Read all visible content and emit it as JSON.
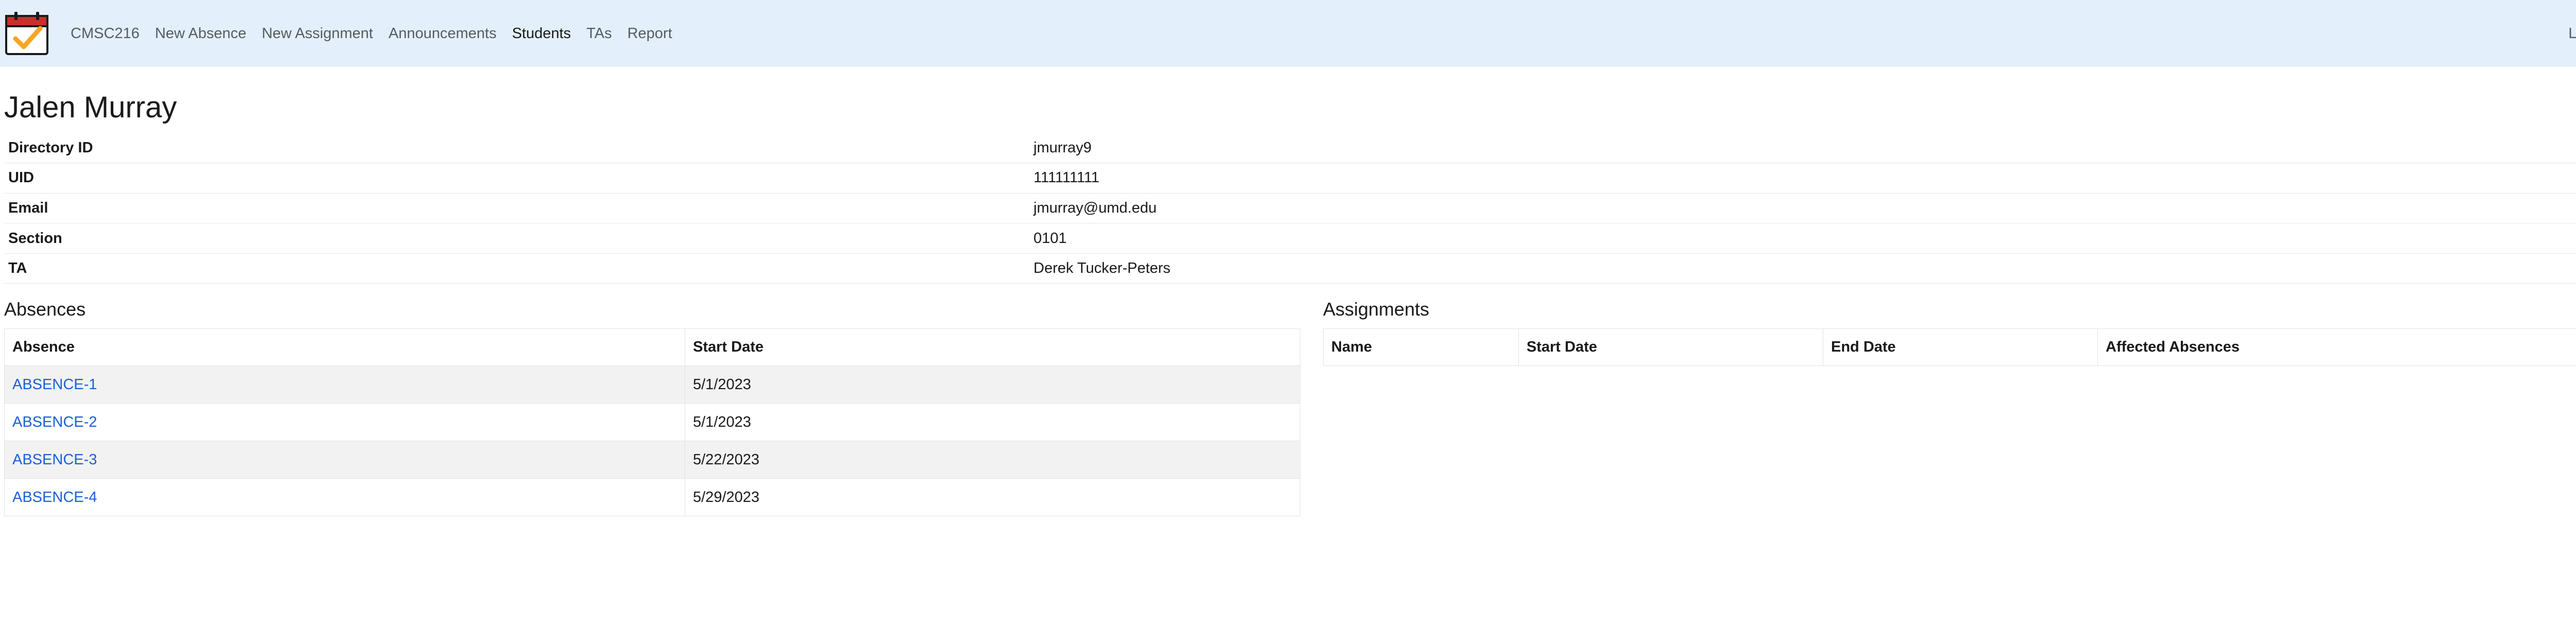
{
  "nav": {
    "brand": "CMSC216",
    "links": [
      "New Absence",
      "New Assignment",
      "Announcements",
      "Students",
      "TAs",
      "Report"
    ],
    "active": "Students",
    "logout": "Logout"
  },
  "student": {
    "name": "Jalen Murray",
    "fields": [
      {
        "label": "Directory ID",
        "value": "jmurray9"
      },
      {
        "label": "UID",
        "value": "111111111"
      },
      {
        "label": "Email",
        "value": "jmurray@umd.edu"
      },
      {
        "label": "Section",
        "value": "0101"
      },
      {
        "label": "TA",
        "value": "Derek Tucker-Peters"
      }
    ]
  },
  "absences": {
    "title": "Absences",
    "headers": [
      "Absence",
      "Start Date"
    ],
    "rows": [
      {
        "name": "ABSENCE-1",
        "start": "5/1/2023"
      },
      {
        "name": "ABSENCE-2",
        "start": "5/1/2023"
      },
      {
        "name": "ABSENCE-3",
        "start": "5/22/2023"
      },
      {
        "name": "ABSENCE-4",
        "start": "5/29/2023"
      }
    ]
  },
  "assignments": {
    "title": "Assignments",
    "headers": [
      "Name",
      "Start Date",
      "End Date",
      "Affected Absences"
    ]
  },
  "colors": {
    "navbar_bg": "#e3f0fb",
    "link": "#1a5fd6",
    "striped_row": "#f2f2f2",
    "logo_red": "#c9302c",
    "logo_check": "#f5a623"
  },
  "icons": {
    "logo": "calendar-check-icon"
  }
}
